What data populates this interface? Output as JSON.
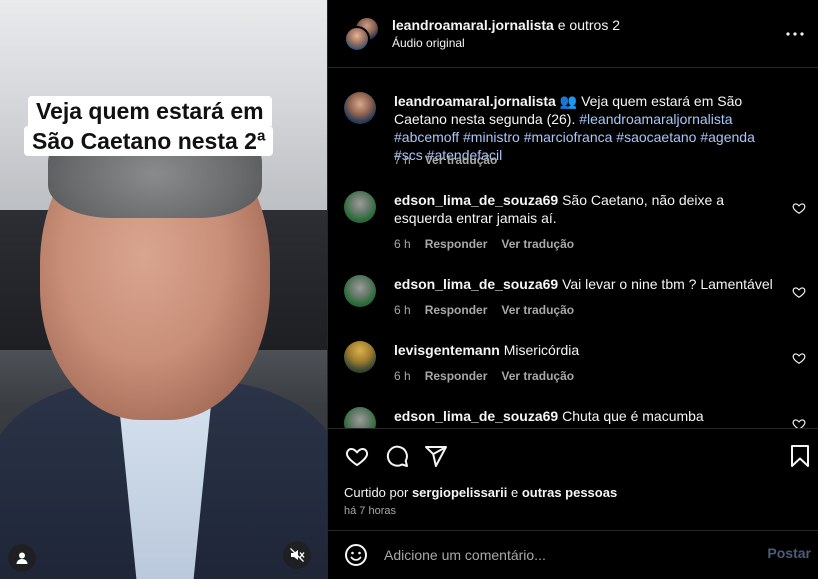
{
  "video": {
    "caption_line1": "Veja quem estará em",
    "caption_line2": "São Caetano nesta 2ª",
    "avatar_icon": "user-icon",
    "mute_icon": "muted-speaker-icon"
  },
  "header": {
    "username": "leandroamaral.jornalista",
    "others": "e outros 2",
    "audio": "Áudio original",
    "more_icon": "more-options-icon"
  },
  "caption_comment": {
    "username": "leandroamaral.jornalista",
    "emoji": "👥",
    "text": "Veja quem estará em São Caetano nesta segunda (26).",
    "hashtags": "#leandroamaraljornalista #abcemoff #ministro #marciofranca #saocaetano #agenda #scs #atendefacil",
    "time": "7 h",
    "translate": "Ver tradução"
  },
  "comments": [
    {
      "username": "edson_lima_de_souza69",
      "text": "São Caetano, não deixe a esquerda entrar jamais aí.",
      "time": "6 h",
      "reply": "Responder",
      "translate": "Ver tradução"
    },
    {
      "username": "edson_lima_de_souza69",
      "text": "Vai levar o nine tbm ? Lamentável",
      "time": "6 h",
      "reply": "Responder",
      "translate": "Ver tradução"
    },
    {
      "username": "levisgentemann",
      "text": "Misericórdia",
      "time": "6 h",
      "reply": "Responder",
      "translate": "Ver tradução"
    },
    {
      "username": "edson_lima_de_souza69",
      "text": "Chuta que é macumba"
    }
  ],
  "actions": {
    "like_icon": "heart-icon",
    "comment_icon": "comment-icon",
    "share_icon": "share-icon",
    "save_icon": "bookmark-icon",
    "liked_prefix": "Curtido por",
    "liked_user": "sergiopelissarii",
    "liked_and": "e",
    "liked_others": "outras pessoas",
    "time": "há 7 horas"
  },
  "add_comment": {
    "placeholder": "Adicione um comentário...",
    "post": "Postar",
    "emoji_icon": "emoji-icon"
  },
  "colors": {
    "background": "#000000",
    "link": "#a8c7fa",
    "muted": "#a8a8a8",
    "post_disabled": "#4a5d7a"
  }
}
